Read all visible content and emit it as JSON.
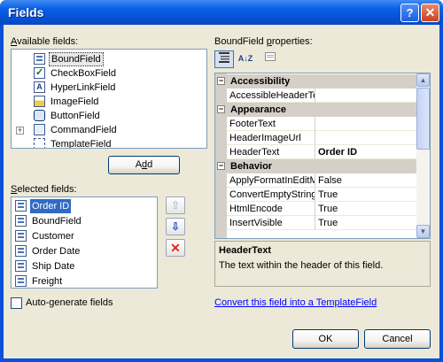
{
  "window": {
    "title": "Fields",
    "help_glyph": "?",
    "close_glyph": "✕"
  },
  "available": {
    "label_accel": "A",
    "label_rest": "vailable fields:",
    "items": [
      {
        "label": "BoundField",
        "icon": "boundfield-icon",
        "selected": true
      },
      {
        "label": "CheckBoxField",
        "icon": "checkbox-field-icon"
      },
      {
        "label": "HyperLinkField",
        "icon": "hyperlink-field-icon"
      },
      {
        "label": "ImageField",
        "icon": "image-field-icon"
      },
      {
        "label": "ButtonField",
        "icon": "button-field-icon"
      },
      {
        "label": "CommandField",
        "icon": "command-field-icon",
        "expandable": true
      },
      {
        "label": "TemplateField",
        "icon": "template-field-icon"
      }
    ],
    "add_pre": "A",
    "add_accel": "d",
    "add_post": "d"
  },
  "selected": {
    "label_pre": "",
    "label_accel": "S",
    "label_rest": "elected fields:",
    "items": [
      "Order ID",
      "BoundField",
      "Customer",
      "Order Date",
      "Ship Date",
      "Freight"
    ],
    "move_up_glyph": "⇧",
    "move_down_glyph": "⇩",
    "delete_glyph": "✕"
  },
  "autogen": {
    "pre": "Auto-",
    "accel": "g",
    "post": "enerate fields",
    "checked": false
  },
  "properties": {
    "label_pre": "BoundField ",
    "label_accel": "p",
    "label_rest": "roperties:",
    "toolbar": {
      "categorized": "categorized-icon",
      "alphabetical": "alphabetical-icon",
      "property_pages": "property-pages-icon",
      "az_text": "A↓Z"
    },
    "rows": [
      {
        "type": "category",
        "name": "Accessibility",
        "glyph": "−"
      },
      {
        "type": "prop",
        "name": "AccessibleHeaderTe",
        "value": ""
      },
      {
        "type": "category",
        "name": "Appearance",
        "glyph": "−"
      },
      {
        "type": "prop",
        "name": "FooterText",
        "value": ""
      },
      {
        "type": "prop",
        "name": "HeaderImageUrl",
        "value": ""
      },
      {
        "type": "prop",
        "name": "HeaderText",
        "value": "Order ID",
        "bold": true
      },
      {
        "type": "category",
        "name": "Behavior",
        "glyph": "−"
      },
      {
        "type": "prop",
        "name": "ApplyFormatInEditM",
        "value": "False"
      },
      {
        "type": "prop",
        "name": "ConvertEmptyString",
        "value": "True"
      },
      {
        "type": "prop",
        "name": "HtmlEncode",
        "value": "True"
      },
      {
        "type": "prop",
        "name": "InsertVisible",
        "value": "True"
      }
    ],
    "description_title": "HeaderText",
    "description_text": "The text within the header of this field.",
    "convert_link": "Convert this field into a TemplateField"
  },
  "buttons": {
    "ok": "OK",
    "cancel": "Cancel"
  },
  "colors": {
    "selection": "#316ac5",
    "title_blue": "#0653d4",
    "dialog_bg": "#ece9d8"
  }
}
